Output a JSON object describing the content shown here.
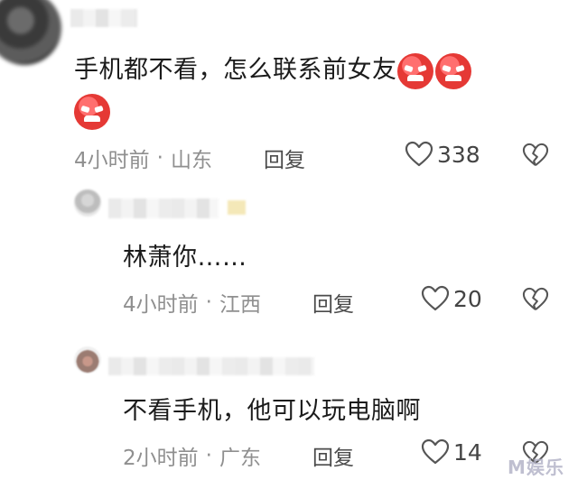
{
  "comments": [
    {
      "text": "手机都不看，怎么联系前女友",
      "time": "4小时前",
      "location": "山东",
      "reply_label": "回复",
      "likes": "338"
    },
    {
      "text": "林萧你……",
      "time": "4小时前",
      "location": "江西",
      "reply_label": "回复",
      "likes": "20"
    },
    {
      "text": "不看手机，他可以玩电脑啊",
      "time": "2小时前",
      "location": "广东",
      "reply_label": "回复",
      "likes": "14"
    }
  ],
  "separator": "·",
  "watermark": "M娱乐",
  "emoji_name": "angry-face-emoji",
  "colors": {
    "emoji_red": "#e53935",
    "meta_gray": "#8f8f8f",
    "text": "#1b1b1b"
  }
}
